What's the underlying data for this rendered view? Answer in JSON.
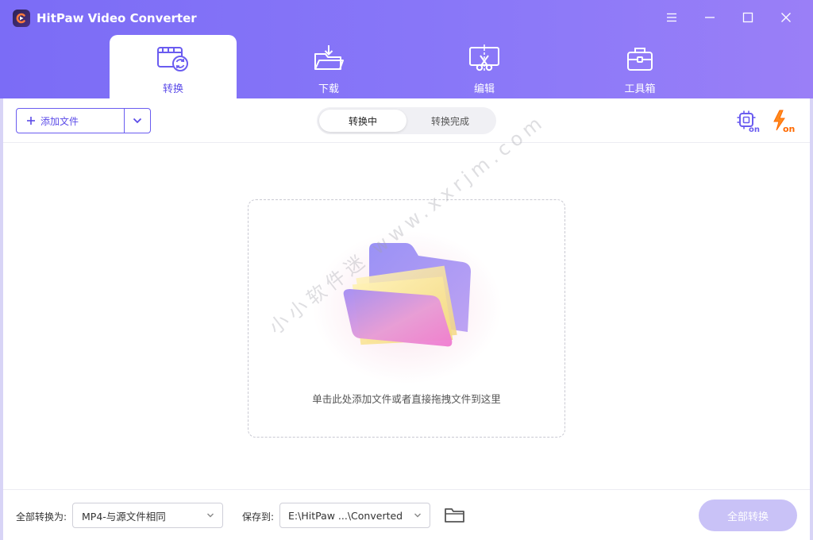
{
  "app": {
    "title": "HitPaw Video Converter"
  },
  "tabs": [
    {
      "label": "转换",
      "icon": "video-convert-icon",
      "active": true
    },
    {
      "label": "下载",
      "icon": "download-folder-icon",
      "active": false
    },
    {
      "label": "编辑",
      "icon": "edit-cut-icon",
      "active": false
    },
    {
      "label": "工具箱",
      "icon": "toolbox-icon",
      "active": false
    }
  ],
  "toolbar": {
    "add_file_label": "添加文件",
    "segments": [
      {
        "label": "转换中",
        "active": true
      },
      {
        "label": "转换完成",
        "active": false
      }
    ],
    "hardware_accel_icon": "cpu-on-icon",
    "turbo_icon": "lightning-on-icon",
    "turbo_badge": "on",
    "hardware_badge": "on"
  },
  "dropzone": {
    "text": "单击此处添加文件或者直接拖拽文件到这里"
  },
  "watermark": "小小软件迷 www.xxrjm.com",
  "footer": {
    "convert_all_to_label": "全部转换为:",
    "format_value": "MP4-与源文件相同",
    "save_to_label": "保存到:",
    "save_path_value": "E:\\HitPaw ...\\Converted",
    "convert_all_button": "全部转换"
  },
  "colors": {
    "accent": "#6a5cf0",
    "header_bg": "#8476f7",
    "convert_btn_disabled": "#c9c2f7"
  }
}
